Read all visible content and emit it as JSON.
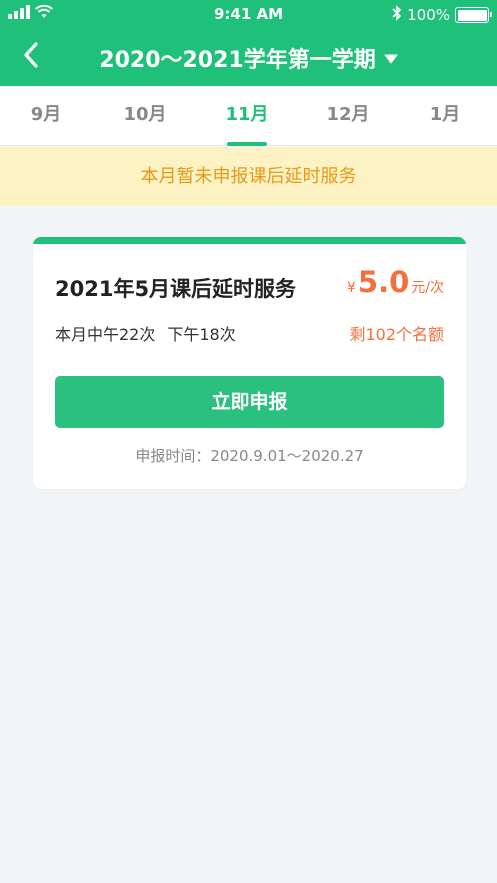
{
  "status_bar": {
    "time": "9:41 AM",
    "battery_text": "100%",
    "icons": [
      "signal-icon",
      "wifi-icon",
      "bluetooth-icon",
      "battery-icon"
    ]
  },
  "nav": {
    "title": "2020～2021学年第一学期",
    "back_icon": "chevron-left-icon",
    "dropdown_icon": "caret-down-icon"
  },
  "tabs": [
    {
      "label": "9月",
      "active": false
    },
    {
      "label": "10月",
      "active": false
    },
    {
      "label": "11月",
      "active": true
    },
    {
      "label": "12月",
      "active": false
    },
    {
      "label": "1月",
      "active": false
    }
  ],
  "notice": {
    "text": "本月暂未申报课后延时服务"
  },
  "card": {
    "title": "2021年5月课后延时服务",
    "price_symbol": "¥",
    "price_value": "5.0",
    "price_unit": "元/次",
    "info_noon": "本月中午22次",
    "info_afternoon": "下午18次",
    "remaining": "剩102个名额",
    "button_label": "立即申报",
    "apply_time": "申报时间：2020.9.01～2020.27"
  },
  "colors": {
    "primary": "#1fc07a",
    "button": "#2bbf80",
    "accent_orange": "#f36f3c",
    "notice_bg": "#fdf2c3",
    "notice_text": "#e79a16",
    "page_bg": "#f2f5f8"
  }
}
